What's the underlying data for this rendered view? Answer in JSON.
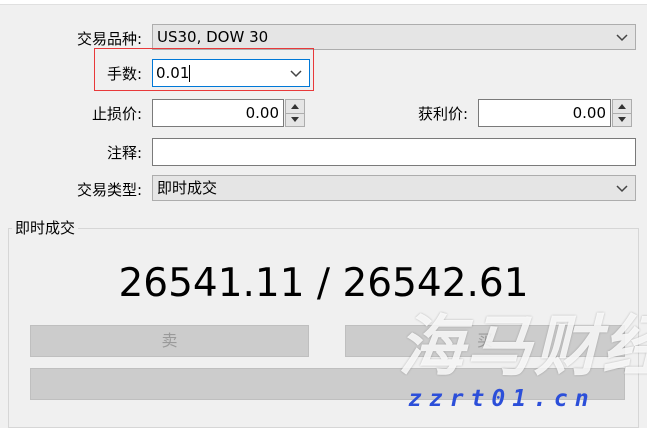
{
  "form": {
    "symbol": {
      "label": "交易品种:",
      "value": "US30, DOW 30"
    },
    "volume": {
      "label": "手数:",
      "value": "0.01"
    },
    "stop_loss": {
      "label": "止损价:",
      "value": "0.00"
    },
    "take_profit": {
      "label": "获利价:",
      "value": "0.00"
    },
    "comment": {
      "label": "注释:",
      "value": ""
    },
    "order_type": {
      "label": "交易类型:",
      "value": "即时成交"
    }
  },
  "execution": {
    "group_title": "即时成交",
    "quote": "26541.11 / 26542.61",
    "sell_label": "卖",
    "buy_label": "买"
  },
  "watermark": {
    "brand": "海马财经",
    "url": "zzrt01.cn"
  },
  "colors": {
    "highlight_border": "#e8393a",
    "focus_border": "#0078d7",
    "watermark_url": "#2c4fd9"
  }
}
